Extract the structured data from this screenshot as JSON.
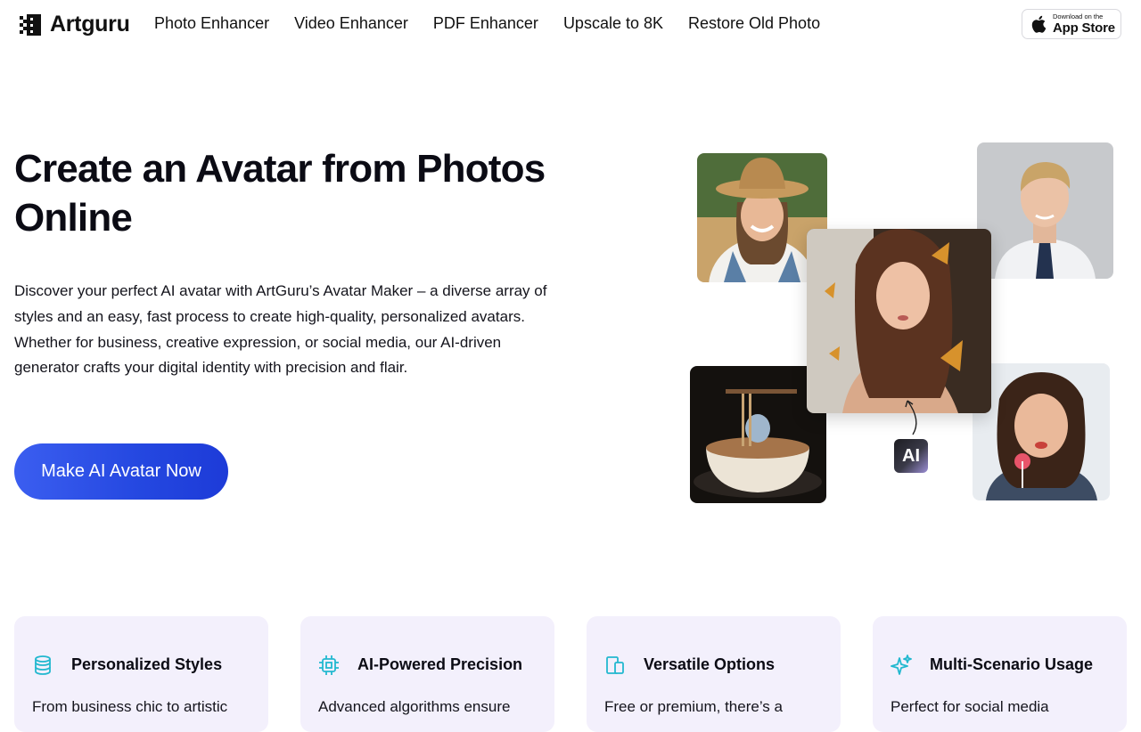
{
  "header": {
    "logo_text": "Artguru",
    "nav": [
      "Photo Enhancer",
      "Video Enhancer",
      "PDF Enhancer",
      "Upscale to 8K",
      "Restore Old Photo"
    ],
    "app_store": {
      "small": "Download on the",
      "big": "App Store"
    }
  },
  "hero": {
    "title": "Create an Avatar from Photos Online",
    "description": "Discover your perfect AI avatar with ArtGuru’s Avatar Maker – a diverse array of styles and an easy, fast process to create high-quality, personalized avatars. Whether for business, creative expression, or social media, our AI-driven generator crafts your digital identity with precision and flair.",
    "cta_label": "Make AI Avatar Now",
    "ai_badge": "AI"
  },
  "features": [
    {
      "icon": "database-stack-icon",
      "title": "Personalized Styles",
      "text": "From business chic to artistic"
    },
    {
      "icon": "cpu-chip-icon",
      "title": "AI-Powered Precision",
      "text": "Advanced algorithms ensure"
    },
    {
      "icon": "devices-icon",
      "title": "Versatile Options",
      "text": "Free or premium, there’s a"
    },
    {
      "icon": "sparkles-icon",
      "title": "Multi-Scenario Usage",
      "text": "Perfect for social media"
    }
  ],
  "colors": {
    "accent": "#2f52e8",
    "icon_teal": "#22b8cf",
    "card_bg": "#f3f0fc"
  }
}
